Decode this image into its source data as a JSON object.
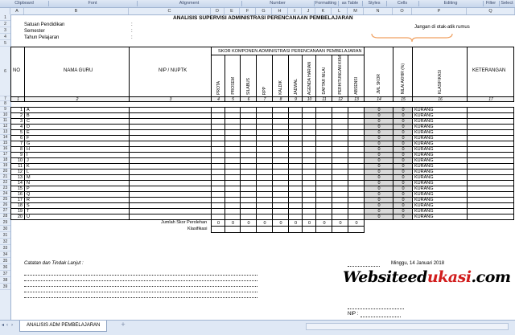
{
  "ribbon": {
    "groups": [
      "Clipboard",
      "Font",
      "Alignment",
      "Number",
      "Formatting",
      "as Table",
      "Styles",
      "Cells",
      "Editing",
      "Filter",
      "Select"
    ]
  },
  "columns": [
    "A",
    "B",
    "C",
    "D",
    "E",
    "F",
    "G",
    "H",
    "I",
    "J",
    "K",
    "L",
    "M",
    "N",
    "O",
    "P",
    "Q"
  ],
  "rows": [
    "1",
    "2",
    "3",
    "4",
    "5",
    "6",
    "7",
    "8",
    "9",
    "10",
    "11",
    "12",
    "13",
    "14",
    "15",
    "16",
    "17",
    "18",
    "19",
    "20",
    "21",
    "22",
    "23",
    "24",
    "25",
    "26",
    "27",
    "28",
    "29",
    "30",
    "31",
    "32",
    "33",
    "34",
    "35",
    "36",
    "37",
    "38",
    "39"
  ],
  "sheet": {
    "title": "ANALISIS SUPERVISI ADMINISTRASI PERENCANAAN PEMBELAJARAN",
    "meta": [
      {
        "label": "Satuan Pendidikan",
        "colon": ":"
      },
      {
        "label": "Semester",
        "colon": ":"
      },
      {
        "label": "Tahun Pelajaran",
        "colon": ":"
      }
    ],
    "note": "Jangan di otak-atik rumus",
    "header": {
      "no": "NO",
      "nama": "NAMA GURU",
      "nip": "NIP / NUPTK",
      "skor_group": "SKOR KOMPONEN ADMINISTRASI PERENCANAAN PEMBELAJARAN",
      "komponen": [
        "PROTA",
        "PROSEM",
        "SILABUS",
        "RPP",
        "KALDIK",
        "JADWAL",
        "AGENDA HARIAN",
        "DAFTAR NILAI",
        "PERHITUNGAN KKM",
        "ABSENSI"
      ],
      "jml_skor": "JML SKOR",
      "nilai_akhir": "NILAI AKHIR (%)",
      "klasifikasi": "KLASIFIKASI",
      "keterangan": "KETERANGAN"
    },
    "col_numbers": [
      "1",
      "2",
      "3",
      "4",
      "5",
      "6",
      "7",
      "8",
      "9",
      "10",
      "11",
      "12",
      "13",
      "14",
      "15",
      "16",
      "17"
    ],
    "teachers": [
      {
        "no": "1",
        "name": "A",
        "jml": "0",
        "nilai": "0",
        "klas": "KURANG"
      },
      {
        "no": "2",
        "name": "B",
        "jml": "0",
        "nilai": "0",
        "klas": "KURANG"
      },
      {
        "no": "3",
        "name": "C",
        "jml": "0",
        "nilai": "0",
        "klas": "KURANG"
      },
      {
        "no": "4",
        "name": "D",
        "jml": "0",
        "nilai": "0",
        "klas": "KURANG"
      },
      {
        "no": "5",
        "name": "E",
        "jml": "0",
        "nilai": "0",
        "klas": "KURANG"
      },
      {
        "no": "6",
        "name": "F",
        "jml": "0",
        "nilai": "0",
        "klas": "KURANG"
      },
      {
        "no": "7",
        "name": "G",
        "jml": "0",
        "nilai": "0",
        "klas": "KURANG"
      },
      {
        "no": "8",
        "name": "H",
        "jml": "0",
        "nilai": "0",
        "klas": "KURANG"
      },
      {
        "no": "9",
        "name": "I",
        "jml": "0",
        "nilai": "0",
        "klas": "KURANG"
      },
      {
        "no": "10",
        "name": "J",
        "jml": "0",
        "nilai": "0",
        "klas": "KURANG"
      },
      {
        "no": "11",
        "name": "K",
        "jml": "0",
        "nilai": "0",
        "klas": "KURANG"
      },
      {
        "no": "12",
        "name": "L",
        "jml": "0",
        "nilai": "0",
        "klas": "KURANG"
      },
      {
        "no": "13",
        "name": "M",
        "jml": "0",
        "nilai": "0",
        "klas": "KURANG"
      },
      {
        "no": "14",
        "name": "N",
        "jml": "0",
        "nilai": "0",
        "klas": "KURANG"
      },
      {
        "no": "15",
        "name": "P",
        "jml": "0",
        "nilai": "0",
        "klas": "KURANG"
      },
      {
        "no": "16",
        "name": "Q",
        "jml": "0",
        "nilai": "0",
        "klas": "KURANG"
      },
      {
        "no": "17",
        "name": "R",
        "jml": "0",
        "nilai": "0",
        "klas": "KURANG"
      },
      {
        "no": "18",
        "name": "S",
        "jml": "0",
        "nilai": "0",
        "klas": "KURANG"
      },
      {
        "no": "19",
        "name": "T",
        "jml": "0",
        "nilai": "0",
        "klas": "KURANG"
      },
      {
        "no": "20",
        "name": "U",
        "jml": "0",
        "nilai": "0",
        "klas": "KURANG"
      }
    ],
    "jumlah_label": "Jumlah Skor Perolehan",
    "jumlah_values": [
      "0",
      "0",
      "0",
      "0",
      "0",
      "0",
      "0",
      "0",
      "0",
      "0"
    ],
    "klasifikasi_label": "Klasifikasi",
    "catatan": "Catatan dan Tindak Lanjut :",
    "date": "Minggu, 14 Januari 2018",
    "nip_label": "NIP :",
    "sheet_tab": "ANALISIS ADM PEMBELAJARAN"
  },
  "watermark": {
    "part1": "Websiteed",
    "part2": "ukasi",
    "part3": ".com",
    "color1": "#000000",
    "color2": "#d11c1c"
  },
  "accent": {
    "bracket": "#f0a060"
  }
}
